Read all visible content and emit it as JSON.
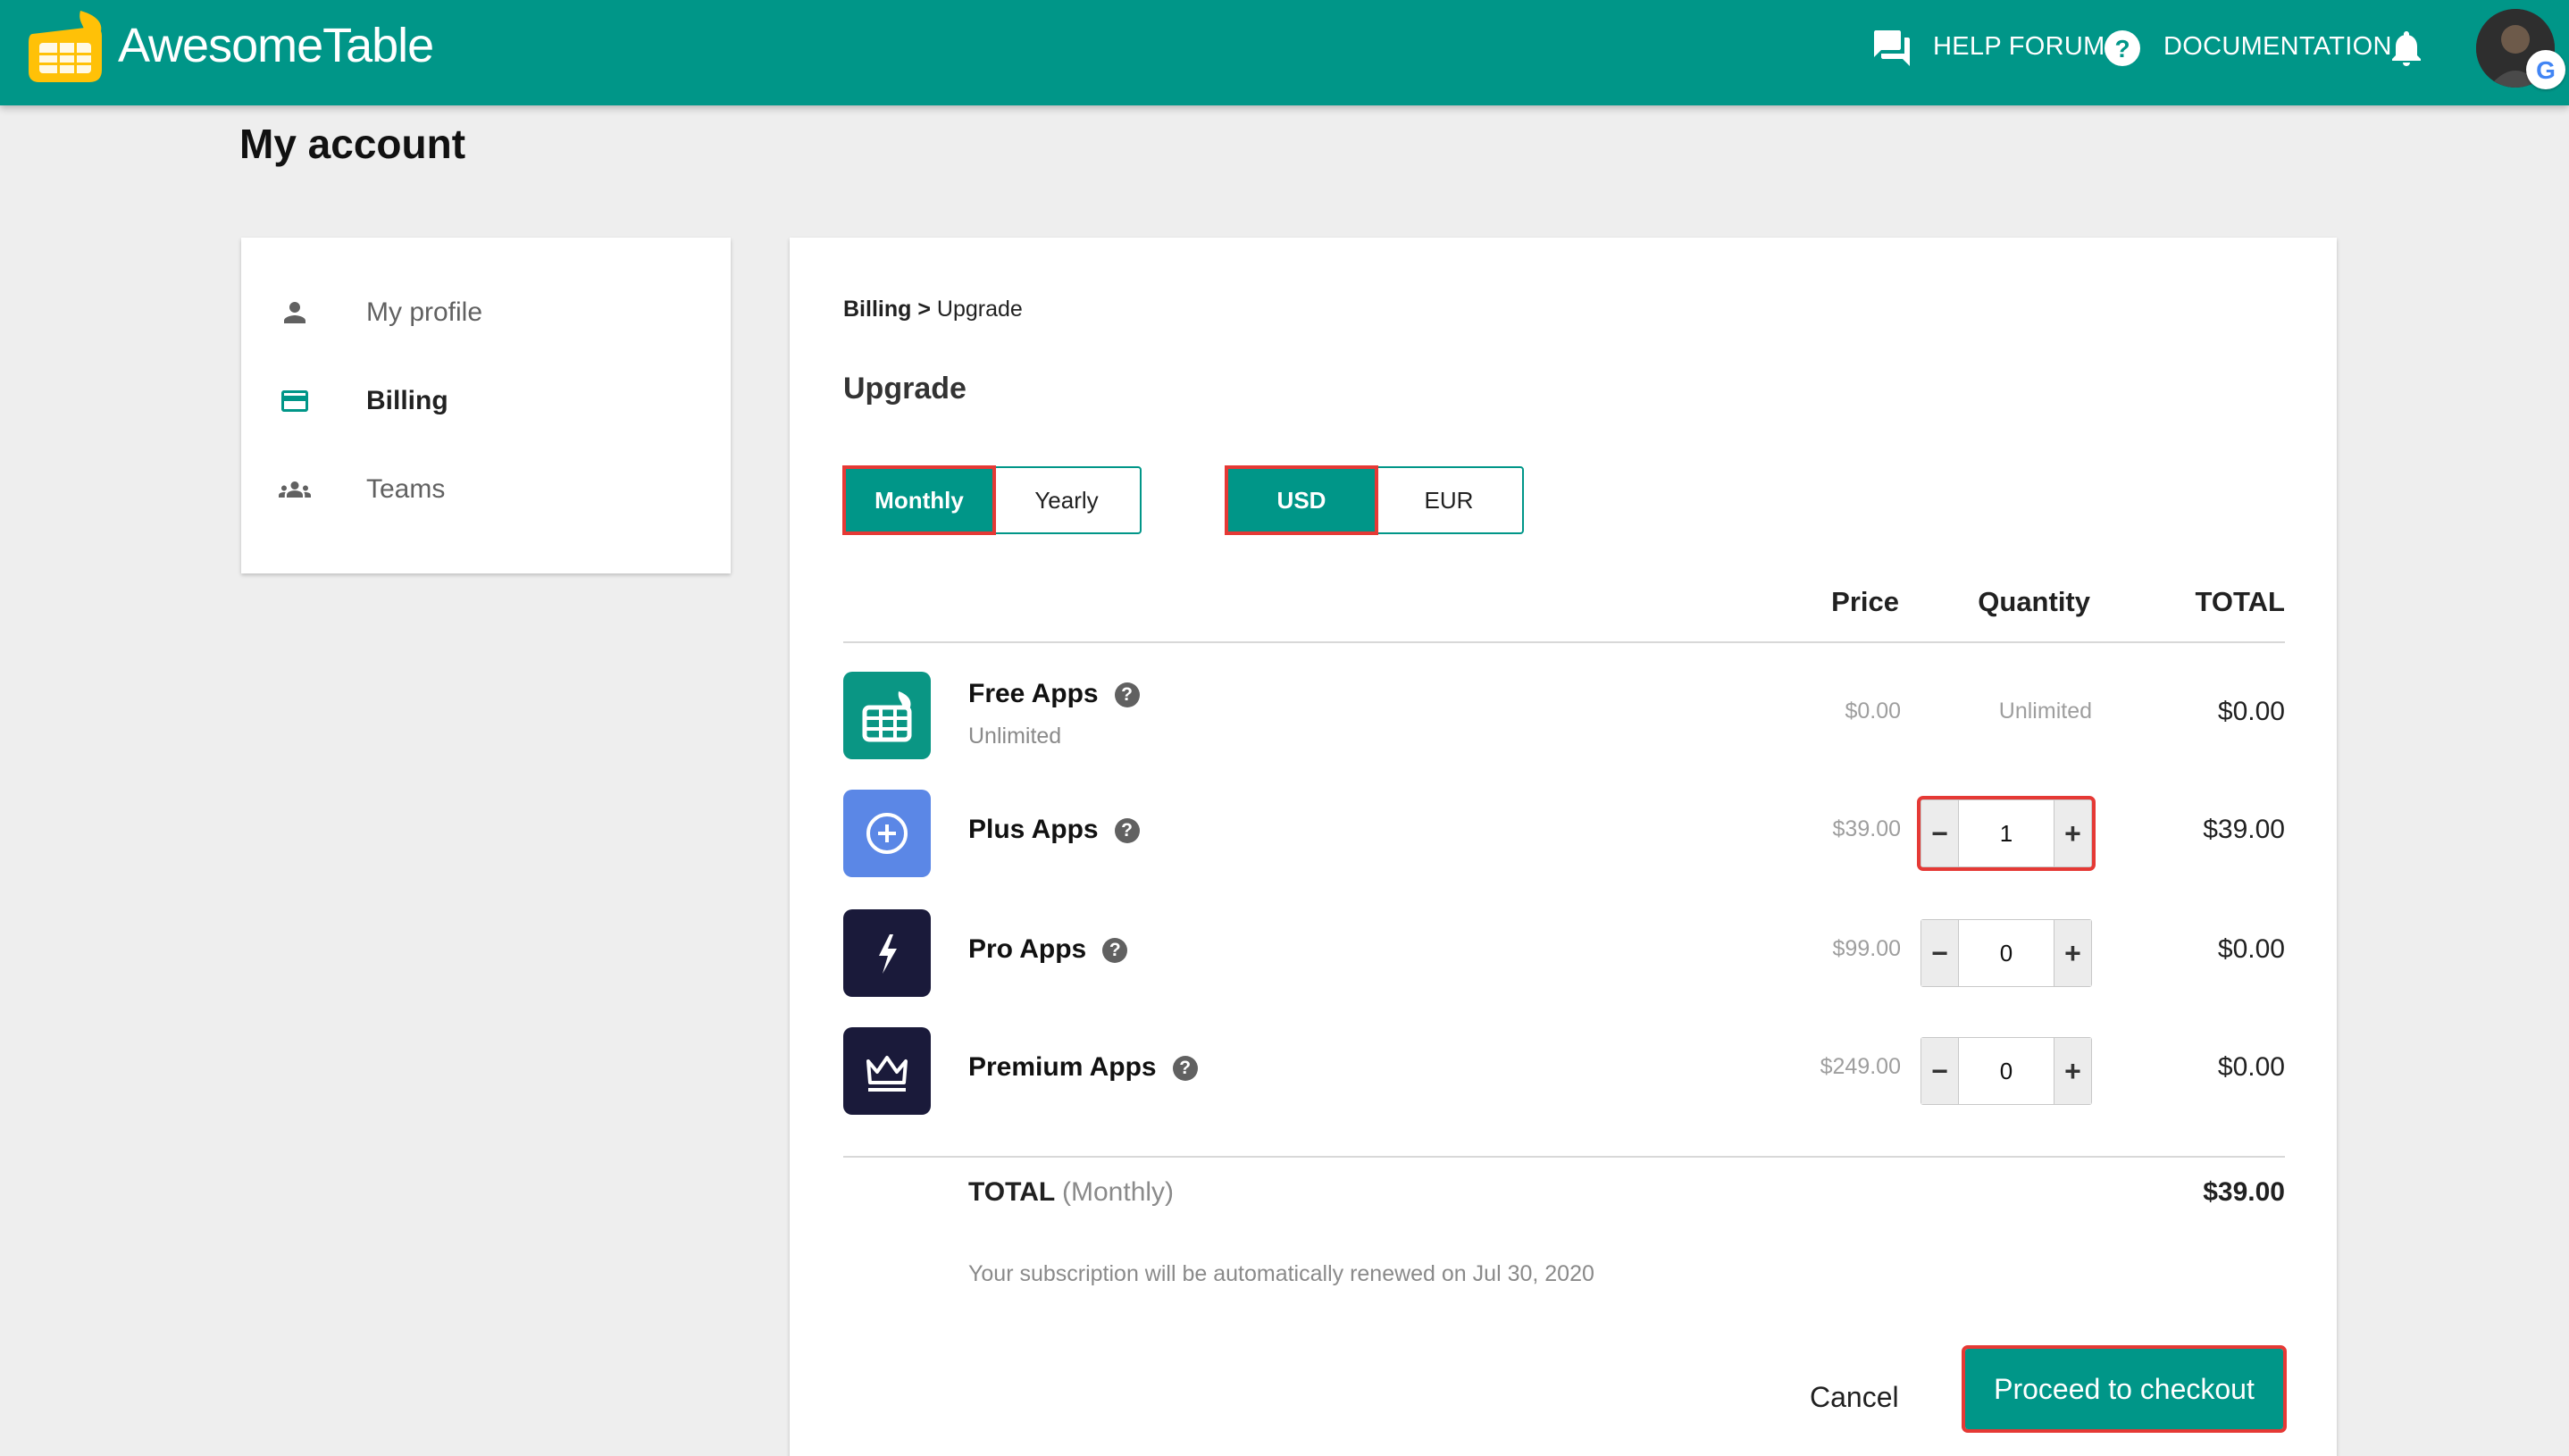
{
  "header": {
    "brand": "AwesomeTable",
    "help_forum": "HELP FORUM",
    "documentation": "DOCUMENTATION",
    "brand_color": "#009688"
  },
  "page": {
    "title": "My account"
  },
  "sidebar": {
    "items": [
      {
        "label": "My profile",
        "icon": "person-icon",
        "active": false
      },
      {
        "label": "Billing",
        "icon": "credit-card-icon",
        "active": true
      },
      {
        "label": "Teams",
        "icon": "people-icon",
        "active": false
      }
    ]
  },
  "billing": {
    "breadcrumb_parent": "Billing",
    "breadcrumb_sep": " > ",
    "breadcrumb_current": "Upgrade",
    "section_title": "Upgrade",
    "period_options": [
      "Monthly",
      "Yearly"
    ],
    "period_selected": "Monthly",
    "currency_options": [
      "USD",
      "EUR"
    ],
    "currency_selected": "USD",
    "columns": {
      "price": "Price",
      "quantity": "Quantity",
      "total": "TOTAL"
    },
    "help_glyph": "?",
    "stepper_minus": "−",
    "stepper_plus": "+",
    "products": [
      {
        "name": "Free Apps",
        "subtitle": "Unlimited",
        "price": "$0.00",
        "quantity": "Unlimited",
        "total": "$0.00",
        "tile_color": "#0a9684",
        "icon": "awesome-table-logo-icon"
      },
      {
        "name": "Plus Apps",
        "price": "$39.00",
        "quantity": "1",
        "total": "$39.00",
        "tile_color": "#5b87e6",
        "icon": "plus-circle-icon"
      },
      {
        "name": "Pro Apps",
        "price": "$99.00",
        "quantity": "0",
        "total": "$0.00",
        "tile_color": "#1a1a3a",
        "icon": "lightning-icon"
      },
      {
        "name": "Premium Apps",
        "price": "$249.00",
        "quantity": "0",
        "total": "$0.00",
        "tile_color": "#1a1a3a",
        "icon": "crown-icon"
      }
    ],
    "total_label": "TOTAL",
    "total_period": "(Monthly)",
    "total_value": "$39.00",
    "renewal_note": "Your subscription will be automatically renewed on Jul 30, 2020",
    "cancel_label": "Cancel",
    "checkout_label": "Proceed to checkout",
    "highlight_color": "#e53935"
  }
}
